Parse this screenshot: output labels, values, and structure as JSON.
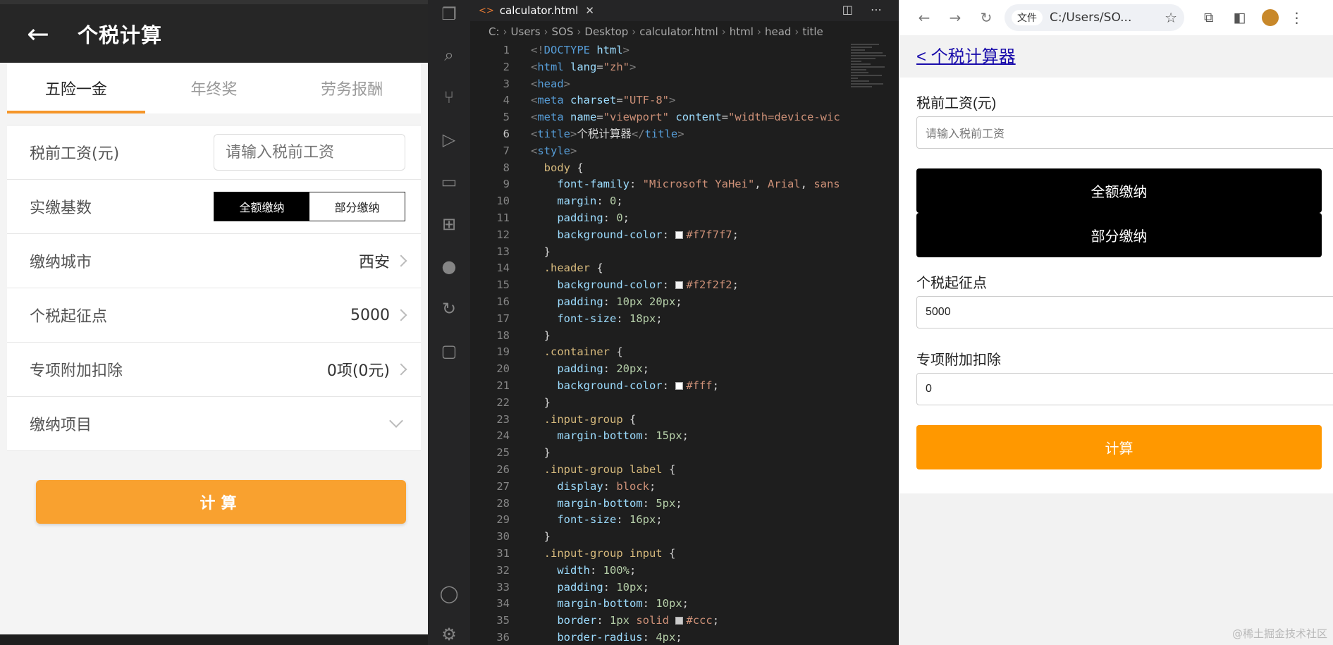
{
  "app": {
    "title": "个税计算",
    "back_icon": "arrow-left-icon",
    "tabs": [
      "五险一金",
      "年终奖",
      "劳务报酬"
    ],
    "rows": {
      "salary_label": "税前工资(元)",
      "salary_placeholder": "请输入税前工资",
      "base_label": "实缴基数",
      "base_full": "全额缴纳",
      "base_part": "部分缴纳",
      "city_label": "缴纳城市",
      "city_value": "西安",
      "threshold_label": "个税起征点",
      "threshold_value": "5000",
      "deduction_label": "专项附加扣除",
      "deduction_value": "0项(0元)",
      "items_label": "缴纳项目"
    },
    "calc_label": "计算",
    "accent": "#f9a12f"
  },
  "vscode": {
    "tab_name": "calculator.html",
    "breadcrumb": [
      "C:",
      "Users",
      "SOS",
      "Desktop",
      "calculator.html",
      "html",
      "head",
      "title"
    ],
    "line_numbers": [
      "1",
      "2",
      "3",
      "4",
      "5",
      "6",
      "7",
      "8",
      "9",
      "10",
      "11",
      "12",
      "13",
      "14",
      "15",
      "16",
      "17",
      "18",
      "19",
      "20",
      "21",
      "22",
      "23",
      "24",
      "25",
      "26",
      "27",
      "28",
      "29",
      "30",
      "31",
      "32",
      "33",
      "34",
      "35",
      "36"
    ]
  },
  "browser": {
    "info_chip": "文件",
    "url": "C:/Users/SO...",
    "page_back_link": "< 个税计算器",
    "salary_label": "税前工资(元)",
    "salary_placeholder": "请输入税前工资",
    "full_pay": "全额缴纳",
    "part_pay": "部分缴纳",
    "threshold_label": "个税起征点",
    "threshold_value": "5000",
    "deduction_label": "专项附加扣除",
    "deduction_value": "0",
    "calc_label": "计算"
  },
  "watermark": "@稀土掘金技术社区"
}
